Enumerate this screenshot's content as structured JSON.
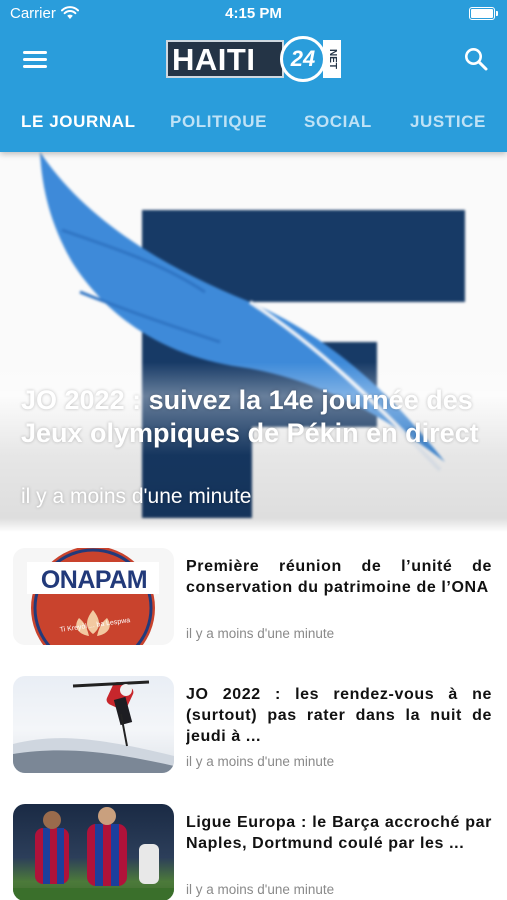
{
  "status_bar": {
    "carrier": "Carrier",
    "time": "4:15 PM"
  },
  "header": {
    "logo": {
      "brand": "HAITI",
      "number": "24",
      "suffix": "NET"
    },
    "tabs": [
      {
        "label": "LE JOURNAL",
        "active": true
      },
      {
        "label": "POLITIQUE",
        "active": false
      },
      {
        "label": "SOCIAL",
        "active": false
      },
      {
        "label": "JUSTICE",
        "active": false
      }
    ]
  },
  "hero": {
    "title": "JO 2022 : suivez la 14e journée des Jeux olympiques de Pékin en direct",
    "time": "il y a moins d'une minute"
  },
  "articles": [
    {
      "title": "Première réunion de l’unité de conservation du patrimoine de l’ONA",
      "time": "il y a moins d'une minute",
      "thumb_logo": "ONAPAM",
      "thumb_caption": "Ti Kreyòl ... ba Lespwa"
    },
    {
      "title": "JO 2022 : les rendez-vous à ne (surtout) pas rater dans la nuit de jeudi à ...",
      "time": "il y a moins d'une minute"
    },
    {
      "title": "Ligue Europa : le Barça accroché par Naples, Dortmund coulé par les ...",
      "time": "il y a moins d'une minute"
    }
  ],
  "colors": {
    "header_bg": "#2a9ddb",
    "logo_dark": "#243446",
    "tab_inactive": "#bfe2f6"
  }
}
